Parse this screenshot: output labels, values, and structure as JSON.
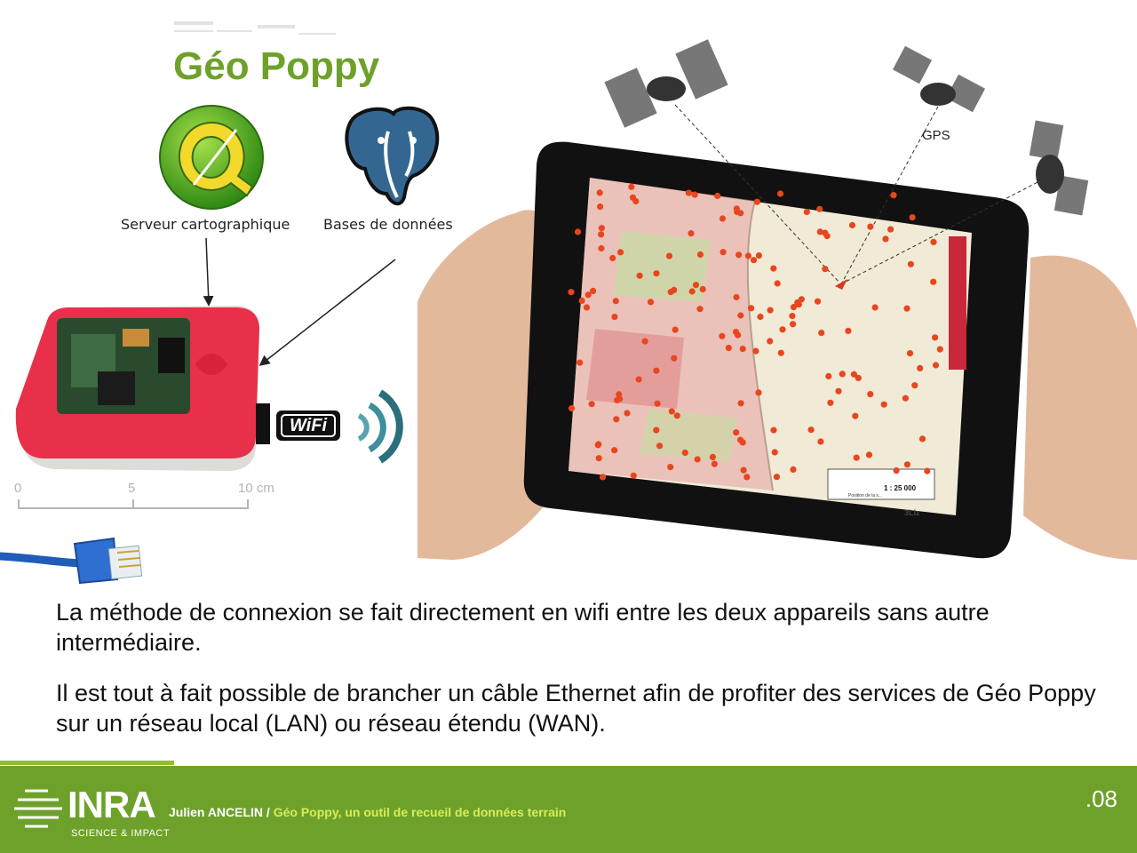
{
  "slide": {
    "title": "Géo Poppy",
    "paragraphs": [
      "La méthode de connexion se fait directement en wifi entre les deux appareils sans autre intermédiaire.",
      "Il est tout à fait possible de brancher un câble Ethernet afin de profiter des services de Géo Poppy sur un réseau local (LAN) ou réseau étendu (WAN)."
    ]
  },
  "figure": {
    "qgis_caption": "Serveur cartographique",
    "postgres_caption": "Bases de données",
    "wifi_label": "WiFi",
    "gps_label": "GPS",
    "ruler": {
      "zero": "0",
      "five": "5",
      "ten": "10 cm"
    },
    "map_scale": "1 : 25 000",
    "map_scale_caption": "Position de la s...",
    "map_brand": "3Liz"
  },
  "footer": {
    "logo_text": "INRA",
    "logo_subtext": "SCIENCE & IMPACT",
    "author": "Julien ANCELIN /",
    "subtitle": " Géo Poppy, un outil de recueil de données terrain",
    "page_number": ".08"
  },
  "colors": {
    "accent_green": "#6ea12a",
    "footer_green": "#6ea12a",
    "pi_red": "#e8304a",
    "subtitle_yellow": "#d8ec5a"
  }
}
